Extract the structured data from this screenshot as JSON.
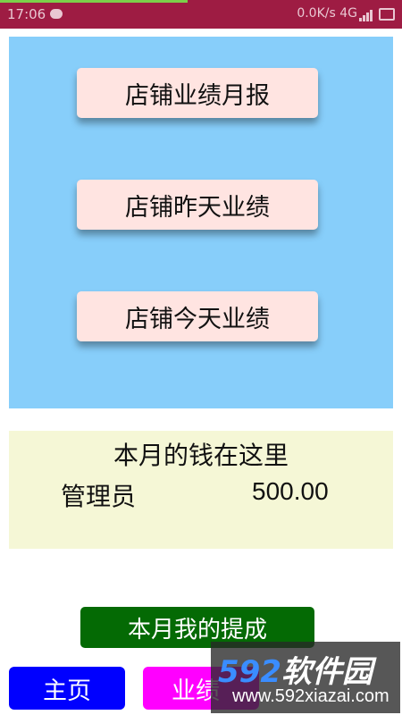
{
  "status_bar": {
    "time": "17:06",
    "network": "0.0K/s",
    "signal": "4G"
  },
  "report_buttons": [
    {
      "label": "店铺业绩月报"
    },
    {
      "label": "店铺昨天业绩"
    },
    {
      "label": "店铺今天业绩"
    }
  ],
  "commission": {
    "title": "本月的钱在这里",
    "role": "管理员",
    "amount": "500.00"
  },
  "my_commission_label": "本月我的提成",
  "bottom_nav": {
    "home": "主页",
    "business": "业绩"
  },
  "watermark": {
    "logo_num": "592",
    "logo_text": "软件园",
    "url": "www.592xiazai.com"
  },
  "colors": {
    "status_bar": "#9e1c43",
    "report_panel": "#87cefa",
    "report_button": "#ffe4e1",
    "commission_panel": "#f5f7d6",
    "my_commission_button": "#046a04",
    "nav_home": "#0000ff",
    "nav_business": "#ff00ff"
  }
}
